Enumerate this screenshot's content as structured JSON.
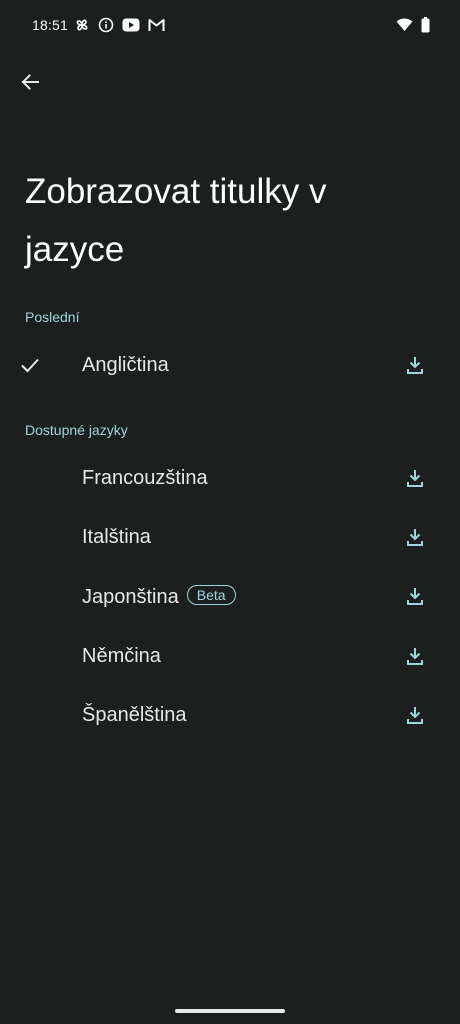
{
  "status_bar": {
    "time": "18:51",
    "left_icons": [
      "pinwheel-icon",
      "info-icon",
      "youtube-icon",
      "gmail-icon"
    ],
    "right_icons": [
      "wifi-icon",
      "battery-icon"
    ]
  },
  "header": {
    "title": "Zobrazovat titulky v jazyce"
  },
  "sections": {
    "recent_label": "Poslední",
    "available_label": "Dostupné jazyky"
  },
  "recent_languages": [
    {
      "label": "Angličtina",
      "selected": true
    }
  ],
  "available_languages": [
    {
      "label": "Francouzština",
      "badge": ""
    },
    {
      "label": "Italština",
      "badge": ""
    },
    {
      "label": "Japonština",
      "badge": "Beta"
    },
    {
      "label": "Němčina",
      "badge": ""
    },
    {
      "label": "Španělština",
      "badge": ""
    }
  ],
  "colors": {
    "background": "#1b1f1e",
    "accent": "#9fd6db",
    "text": "#e6e9e8"
  }
}
